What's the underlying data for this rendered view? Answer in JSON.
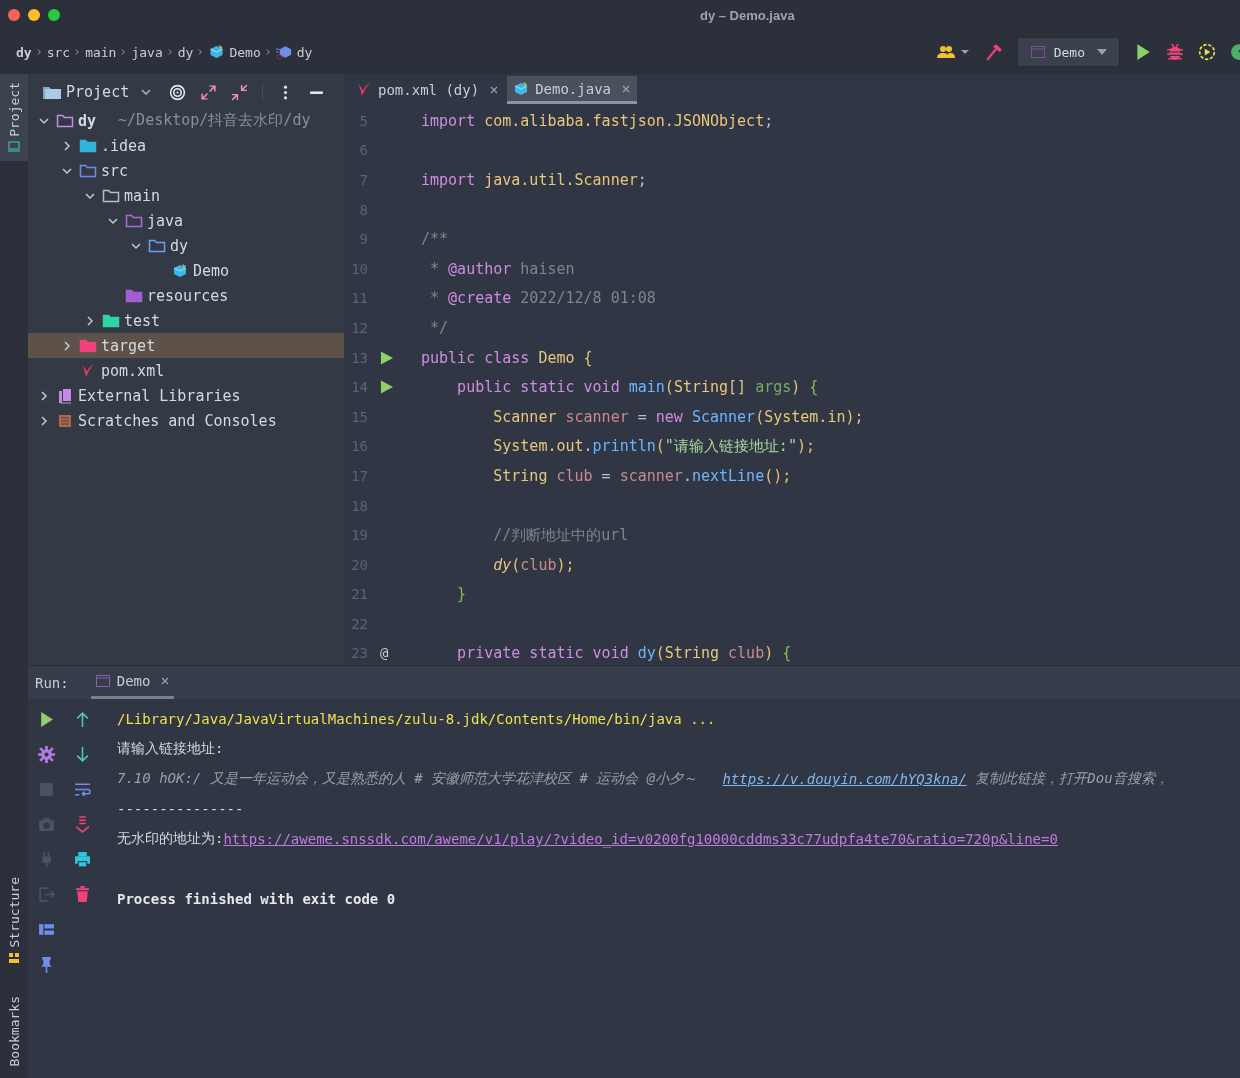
{
  "window": {
    "title": "dy – Demo.java"
  },
  "breadcrumbs": [
    {
      "label": "dy",
      "kind": "folder"
    },
    {
      "label": "src",
      "kind": "folder"
    },
    {
      "label": "main",
      "kind": "folder"
    },
    {
      "label": "java",
      "kind": "folder"
    },
    {
      "label": "dy",
      "kind": "folder"
    },
    {
      "label": "Demo",
      "kind": "class"
    },
    {
      "label": "dy",
      "kind": "method"
    }
  ],
  "toolbar": {
    "run_config": "Demo"
  },
  "side_tabs_top": [
    {
      "label": "Project",
      "selected": true
    }
  ],
  "side_tabs_bottom": [
    {
      "label": "Structure",
      "selected": false
    },
    {
      "label": "Bookmarks",
      "selected": false
    }
  ],
  "project": {
    "title": "Project",
    "tree": [
      {
        "label": "dy",
        "hint": "~/Desktop/抖音去水印/dy",
        "kind": "module",
        "expanded": true,
        "selected": false,
        "children": [
          {
            "label": ".idea",
            "kind": "idea",
            "expanded": false,
            "selected": false
          },
          {
            "label": "src",
            "kind": "src",
            "expanded": true,
            "selected": false,
            "children": [
              {
                "label": "main",
                "kind": "folder",
                "expanded": true,
                "selected": false,
                "children": [
                  {
                    "label": "java",
                    "kind": "sources",
                    "expanded": true,
                    "selected": false,
                    "children": [
                      {
                        "label": "dy",
                        "kind": "package",
                        "expanded": true,
                        "selected": false,
                        "children": [
                          {
                            "label": "Demo",
                            "kind": "class",
                            "selected": false
                          }
                        ]
                      }
                    ]
                  },
                  {
                    "label": "resources",
                    "kind": "resources",
                    "selected": false
                  }
                ]
              },
              {
                "label": "test",
                "kind": "test",
                "expanded": false,
                "selected": false
              }
            ]
          },
          {
            "label": "target",
            "kind": "excluded",
            "expanded": false,
            "selected": true
          },
          {
            "label": "pom.xml",
            "kind": "maven",
            "selected": false
          }
        ]
      },
      {
        "label": "External Libraries",
        "kind": "libraries",
        "expanded": false,
        "selected": false
      },
      {
        "label": "Scratches and Consoles",
        "kind": "scratches",
        "expanded": false,
        "selected": false
      }
    ]
  },
  "editor_tabs": [
    {
      "label": "pom.xml (dy)",
      "kind": "maven",
      "selected": false
    },
    {
      "label": "Demo.java",
      "kind": "class",
      "selected": true
    }
  ],
  "code": [
    {
      "number": "5",
      "tokens": [
        {
          "text": "import ",
          "kind": "kw"
        },
        {
          "text": "com.alibaba.fastjson.JSONObject",
          "kind": "type"
        },
        {
          "text": ";",
          "kind": "plain"
        }
      ]
    },
    {
      "number": "6"
    },
    {
      "number": "7",
      "tokens": [
        {
          "text": "import ",
          "kind": "kw"
        },
        {
          "text": "java.util.Scanner",
          "kind": "type"
        },
        {
          "text": ";",
          "kind": "plain"
        }
      ]
    },
    {
      "number": "8"
    },
    {
      "number": "9",
      "tokens": [
        {
          "text": "/**",
          "kind": "comment"
        }
      ]
    },
    {
      "number": "10",
      "tokens": [
        {
          "text": " * ",
          "kind": "comment"
        },
        {
          "text": "@author",
          "kind": "doctag"
        },
        {
          "text": " haisen",
          "kind": "comment"
        }
      ]
    },
    {
      "number": "11",
      "tokens": [
        {
          "text": " * ",
          "kind": "comment"
        },
        {
          "text": "@create",
          "kind": "doctag"
        },
        {
          "text": " 2022/12/8 01:08",
          "kind": "comment"
        }
      ]
    },
    {
      "number": "12",
      "tokens": [
        {
          "text": " */",
          "kind": "comment"
        }
      ]
    },
    {
      "number": "13",
      "runnable": true,
      "tokens": [
        {
          "text": "public class ",
          "kind": "kw"
        },
        {
          "text": "Demo ",
          "kind": "type"
        },
        {
          "text": "{",
          "kind": "paren"
        }
      ]
    },
    {
      "number": "14",
      "runnable": true,
      "tokens": [
        {
          "text": "    public static void ",
          "kind": "kw"
        },
        {
          "text": "main",
          "kind": "fn"
        },
        {
          "text": "(",
          "kind": "paren"
        },
        {
          "text": "String",
          "kind": "type"
        },
        {
          "text": "[] ",
          "kind": "paren"
        },
        {
          "text": "args",
          "kind": "param"
        },
        {
          "text": ") ",
          "kind": "paren"
        },
        {
          "text": "{",
          "kind": "brace"
        }
      ]
    },
    {
      "number": "15",
      "tokens": [
        {
          "text": "        Scanner ",
          "kind": "type"
        },
        {
          "text": "scanner",
          "kind": "local"
        },
        {
          "text": " = ",
          "kind": "plain"
        },
        {
          "text": "new ",
          "kind": "kw"
        },
        {
          "text": "Scanner",
          "kind": "fn"
        },
        {
          "text": "(",
          "kind": "paren"
        },
        {
          "text": "System.",
          "kind": "type"
        },
        {
          "text": "in",
          "kind": "type"
        },
        {
          "text": ");",
          "kind": "paren"
        }
      ]
    },
    {
      "number": "16",
      "tokens": [
        {
          "text": "        System.",
          "kind": "type"
        },
        {
          "text": "out",
          "kind": "type"
        },
        {
          "text": ".",
          "kind": "plain"
        },
        {
          "text": "println",
          "kind": "fn"
        },
        {
          "text": "(",
          "kind": "paren"
        },
        {
          "text": "\"请输入链接地址:\"",
          "kind": "str"
        },
        {
          "text": ");",
          "kind": "paren"
        }
      ]
    },
    {
      "number": "17",
      "tokens": [
        {
          "text": "        String ",
          "kind": "type"
        },
        {
          "text": "club",
          "kind": "local"
        },
        {
          "text": " = ",
          "kind": "plain"
        },
        {
          "text": "scanner",
          "kind": "local"
        },
        {
          "text": ".",
          "kind": "plain"
        },
        {
          "text": "nextLine",
          "kind": "fn"
        },
        {
          "text": "();",
          "kind": "paren"
        }
      ]
    },
    {
      "number": "18"
    },
    {
      "number": "19",
      "tokens": [
        {
          "text": "        //判断地址中的url",
          "kind": "comment"
        }
      ]
    },
    {
      "number": "20",
      "tokens": [
        {
          "text": "        dy",
          "kind": "static"
        },
        {
          "text": "(",
          "kind": "paren"
        },
        {
          "text": "club",
          "kind": "local"
        },
        {
          "text": ");",
          "kind": "paren"
        }
      ]
    },
    {
      "number": "21",
      "tokens": [
        {
          "text": "    }",
          "kind": "brace"
        }
      ]
    },
    {
      "number": "22"
    },
    {
      "number": "23",
      "gutter_text": "@",
      "tokens": [
        {
          "text": "    private static void ",
          "kind": "kw"
        },
        {
          "text": "dy",
          "kind": "fn"
        },
        {
          "text": "(",
          "kind": "paren"
        },
        {
          "text": "String ",
          "kind": "type"
        },
        {
          "text": "club",
          "kind": "local"
        },
        {
          "text": ") ",
          "kind": "paren"
        },
        {
          "text": "{",
          "kind": "brace"
        }
      ]
    }
  ],
  "run": {
    "label": "Run:",
    "tabs": [
      {
        "label": "Demo",
        "selected": true
      }
    ],
    "console": [
      {
        "segments": [
          {
            "text": "/Library/Java/JavaVirtualMachines/zulu-8.jdk/Contents/Home/bin/java ...",
            "kind": "command"
          }
        ]
      },
      {
        "segments": [
          {
            "text": "请输入链接地址:",
            "kind": "output"
          }
        ]
      },
      {
        "segments": [
          {
            "text": "7.10 hOK:/ 又是一年运动会，又是熟悉的人 # 安徽师范大学花津校区 # 运动会 @小夕～   ",
            "kind": "input"
          },
          {
            "text": "https://v.douyin.com/hYQ3kna/",
            "kind": "input-link"
          },
          {
            "text": " 复制此链接，打开Dou音搜索，",
            "kind": "input"
          }
        ]
      },
      {
        "segments": [
          {
            "text": "---------------",
            "kind": "output"
          }
        ]
      },
      {
        "segments": [
          {
            "text": "无水印的地址为:",
            "kind": "output"
          },
          {
            "text": "https://aweme.snssdk.com/aweme/v1/play/?video_id=v0200fg10000cddms33c77udpfa4te70&ratio=720p&line=0",
            "kind": "link"
          }
        ]
      },
      {
        "blank_before": true,
        "segments": [
          {
            "text": "Process finished with exit code 0",
            "kind": "exit"
          }
        ]
      }
    ]
  }
}
